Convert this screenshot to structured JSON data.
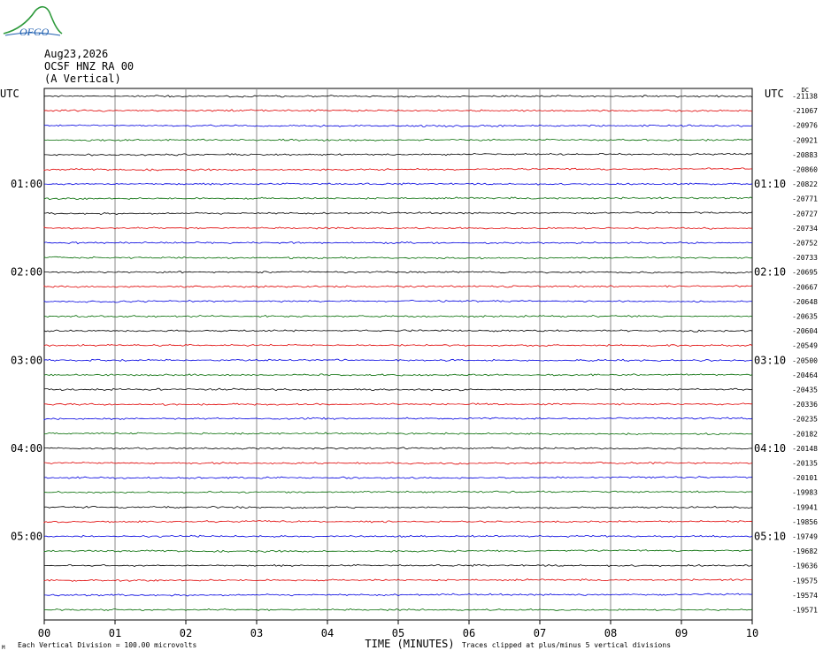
{
  "logo": {
    "text": "OFGO",
    "colors": [
      "#2e9a3c",
      "#1f5fb0"
    ]
  },
  "header": {
    "date": "Aug23,2026",
    "station": "OCSF HNZ RA 00",
    "component": "(A Vertical)"
  },
  "chart_data": {
    "type": "line",
    "title": "",
    "xlabel": "TIME (MINUTES)",
    "ylabel": "",
    "x_ticks": [
      "00",
      "01",
      "02",
      "03",
      "04",
      "05",
      "06",
      "07",
      "08",
      "09",
      "10"
    ],
    "xlim": [
      0,
      10
    ],
    "left_label_header": "UTC",
    "right_label_header": "UTC",
    "dc_header": "DC",
    "left_time_labels": [
      {
        "row": 6,
        "text": "01:00"
      },
      {
        "row": 12,
        "text": "02:00"
      },
      {
        "row": 18,
        "text": "03:00"
      },
      {
        "row": 24,
        "text": "04:00"
      },
      {
        "row": 30,
        "text": "05:00"
      }
    ],
    "right_time_labels": [
      {
        "row": 6,
        "text": "01:10"
      },
      {
        "row": 12,
        "text": "02:10"
      },
      {
        "row": 18,
        "text": "03:10"
      },
      {
        "row": 24,
        "text": "04:10"
      },
      {
        "row": 30,
        "text": "05:10"
      }
    ],
    "dc_offsets": [
      -21138,
      -21067,
      -20976,
      -20921,
      -20883,
      -20860,
      -20822,
      -20771,
      -20727,
      -20734,
      -20752,
      -20733,
      -20695,
      -20667,
      -20648,
      -20635,
      -20604,
      -20549,
      -20500,
      -20464,
      -20435,
      -20336,
      -20235,
      -20182,
      -20148,
      -20135,
      -20101,
      -19983,
      -19941,
      -19856,
      -19749,
      -19682,
      -19636,
      -19575,
      -19574,
      -19571
    ],
    "trace_colors": [
      "#000000",
      "#e00000",
      "#0000e0",
      "#006a00"
    ],
    "rows_per_hour": 6,
    "minutes_per_row": 10,
    "grid": true,
    "footer_left": "Each Vertical Division =  100.00 microvolts",
    "footer_right": "Traces clipped at plus/minus 5 vertical divisions",
    "footer_mark": "M"
  }
}
